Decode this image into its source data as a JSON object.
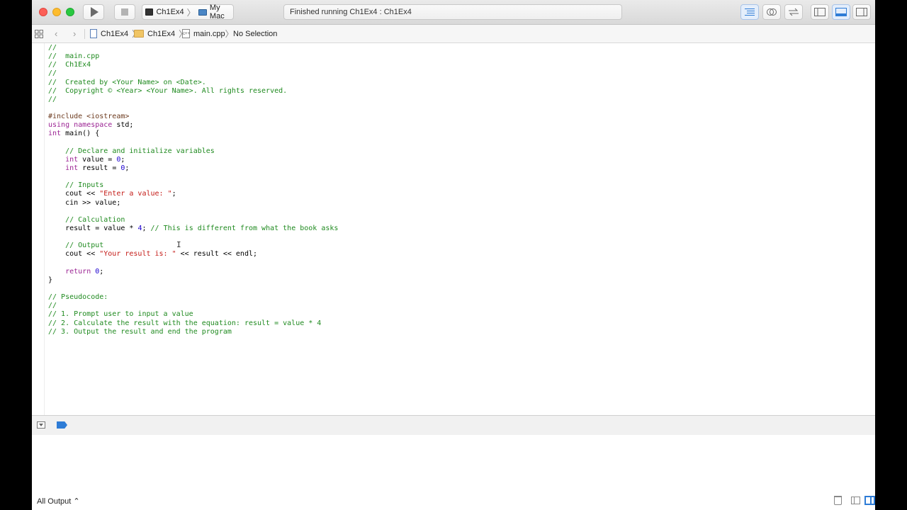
{
  "toolbar": {
    "scheme_target": "Ch1Ex4",
    "scheme_device": "My Mac",
    "status": "Finished running Ch1Ex4 : Ch1Ex4"
  },
  "jumpbar": {
    "project": "Ch1Ex4",
    "group": "Ch1Ex4",
    "file": "main.cpp",
    "symbol": "No Selection"
  },
  "editor": {
    "lines": [
      "//",
      "//  main.cpp",
      "//  Ch1Ex4",
      "//",
      "//  Created by <Your Name> on <Date>.",
      "//  Copyright © <Year> <Your Name>. All rights reserved.",
      "//",
      "",
      "#include <iostream>",
      "using namespace std;",
      "int main() {",
      "",
      "    // Declare and initialize variables",
      "    int value = 0;",
      "    int result = 0;",
      "",
      "    // Inputs",
      "    cout << \"Enter a value: \";",
      "    cin >> value;",
      "",
      "    // Calculation",
      "    result = value * 4; // This is different from what the book asks",
      "",
      "    // Output",
      "    cout << \"Your result is: \" << result << endl;",
      "",
      "    return 0;",
      "}",
      "",
      "// Pseudocode:",
      "//",
      "// 1. Prompt user to input a value",
      "// 2. Calculate the result with the equation: result = value * 4",
      "// 3. Output the result and end the program"
    ]
  },
  "console": {
    "output_filter": "All Output ⌃"
  },
  "colors": {
    "comment": "#1f8a1f",
    "keyword": "#9b2393",
    "string": "#c41a16",
    "number": "#1c00cf",
    "accent": "#2e7cd6"
  },
  "icons": [
    "play-icon",
    "stop-icon",
    "terminal-icon",
    "mac-icon",
    "editor-standard-icon",
    "editor-assistant-icon",
    "editor-version-icon",
    "navigator-toggle-icon",
    "debug-toggle-icon",
    "utilities-toggle-icon",
    "related-items-icon",
    "back-icon",
    "forward-icon",
    "project-file-icon",
    "folder-icon",
    "cpp-file-icon",
    "hide-debug-icon",
    "breakpoints-icon",
    "trash-icon",
    "variables-view-icon",
    "console-view-icon"
  ]
}
